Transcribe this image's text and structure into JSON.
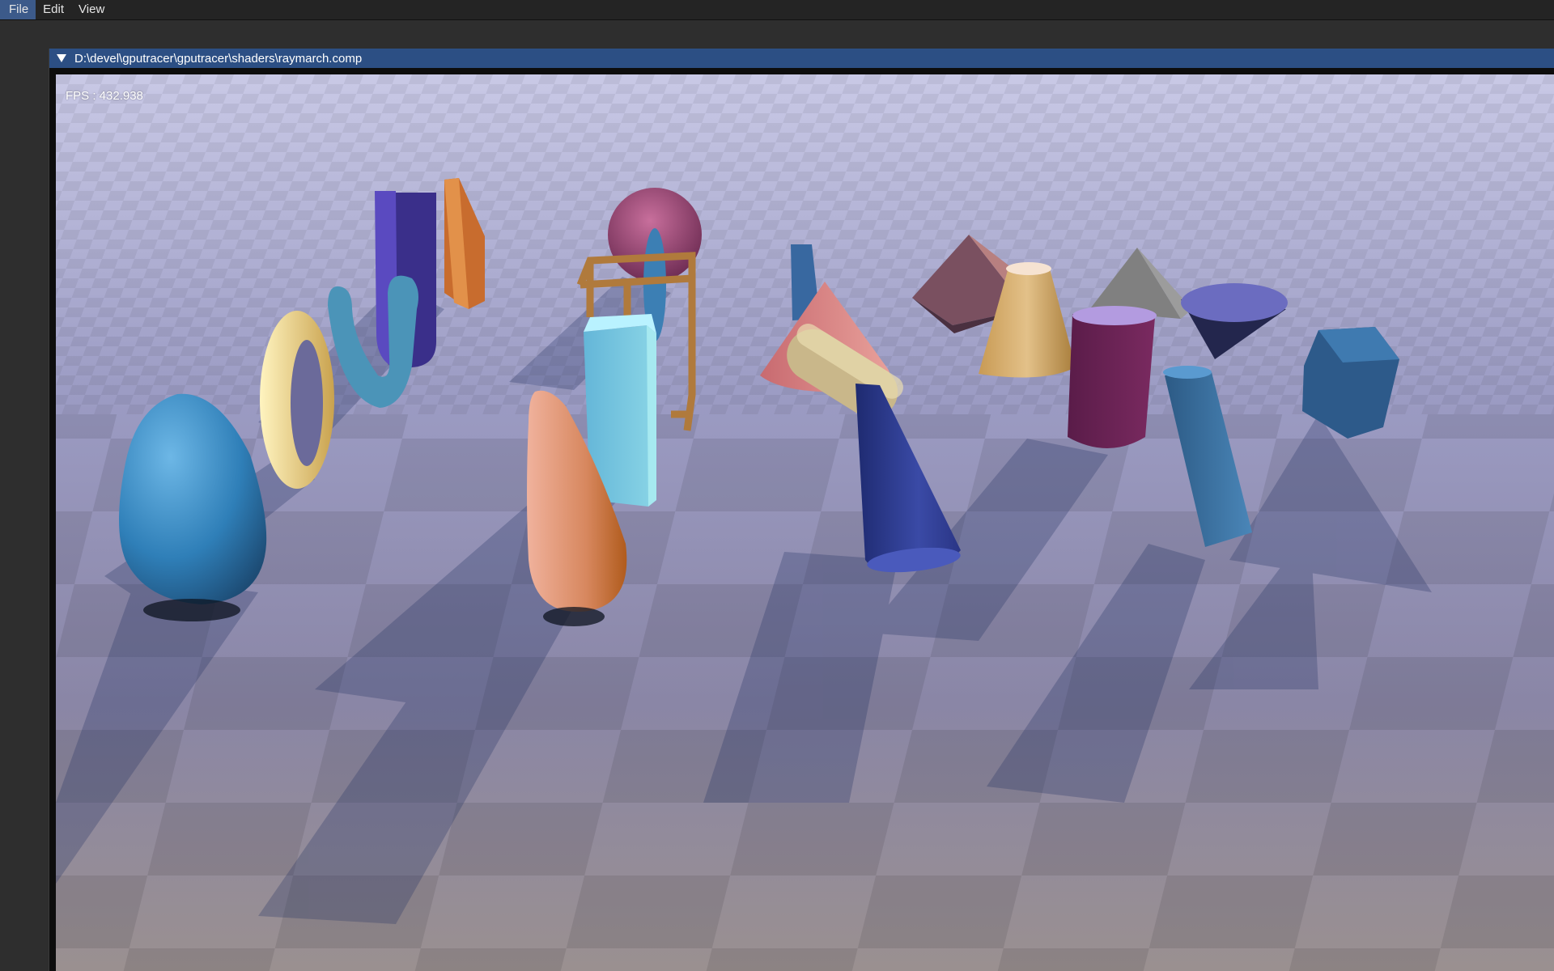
{
  "menu": {
    "items": [
      "File",
      "Edit",
      "View"
    ]
  },
  "window": {
    "title": "D:\\devel\\gputracer\\gputracer\\shaders\\raymarch.comp"
  },
  "viewport": {
    "fps_text": "FPS : 432.938",
    "scene": "raymarched-sdf-primitives-on-checker-floor"
  },
  "colors": {
    "titlebar": "#2c4f84",
    "menubar": "#242424",
    "background": "#2e2e2e"
  }
}
